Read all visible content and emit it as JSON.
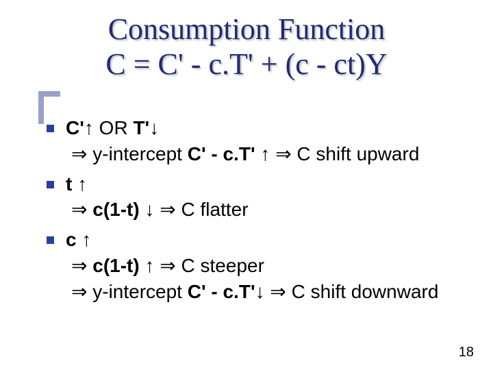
{
  "title": {
    "line1": "Consumption Function",
    "line2": "C = C' - c.T' + (c - ct)Y"
  },
  "sym": {
    "up": "↑",
    "down": "↓",
    "therefore": "⇒"
  },
  "bullets": [
    {
      "head": [
        {
          "t": "C'",
          "b": true
        },
        {
          "sym": "up"
        },
        {
          "t": "  OR "
        },
        {
          "t": "T'",
          "b": true
        },
        {
          "sym": "down"
        }
      ],
      "subs": [
        [
          {
            "sym": "therefore"
          },
          {
            "t": " y-intercept "
          },
          {
            "t": "C' - c.T'",
            "b": true
          },
          {
            "t": " "
          },
          {
            "sym": "up"
          },
          {
            "t": " "
          },
          {
            "sym": "therefore"
          },
          {
            "t": " C shift upward"
          }
        ]
      ]
    },
    {
      "head": [
        {
          "t": "t",
          "b": true
        },
        {
          "t": " "
        },
        {
          "sym": "up"
        }
      ],
      "subs": [
        [
          {
            "sym": "therefore"
          },
          {
            "t": " "
          },
          {
            "t": "c(1-t)",
            "b": true
          },
          {
            "t": " "
          },
          {
            "sym": "down"
          },
          {
            "t": " "
          },
          {
            "sym": "therefore"
          },
          {
            "t": "  C flatter"
          }
        ]
      ]
    },
    {
      "head": [
        {
          "t": "c",
          "b": true
        },
        {
          "t": " "
        },
        {
          "sym": "up"
        }
      ],
      "subs": [
        [
          {
            "sym": "therefore"
          },
          {
            "t": " "
          },
          {
            "t": "c(1-t)",
            "b": true
          },
          {
            "t": " "
          },
          {
            "sym": "up"
          },
          {
            "t": " "
          },
          {
            "sym": "therefore"
          },
          {
            "t": " C steeper"
          }
        ],
        [
          {
            "sym": "therefore"
          },
          {
            "t": " y-intercept "
          },
          {
            "t": "C' - c.T'",
            "b": true
          },
          {
            "sym": "down"
          },
          {
            "t": " "
          },
          {
            "sym": "therefore"
          },
          {
            "t": " C shift downward"
          }
        ]
      ]
    }
  ],
  "page": "18"
}
